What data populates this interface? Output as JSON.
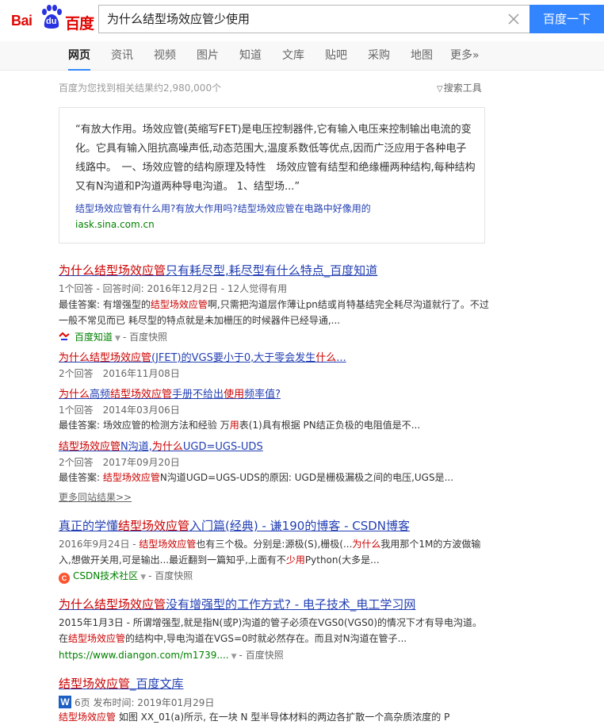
{
  "header": {
    "logo_left": "Bai",
    "logo_du": "du",
    "logo_right": "百度",
    "query": "为什么结型场效应管少使用",
    "search_button": "百度一下"
  },
  "tabs": [
    "网页",
    "资讯",
    "视频",
    "图片",
    "知道",
    "文库",
    "贴吧",
    "采购",
    "地图",
    "更多»"
  ],
  "stats": "百度为您找到相关结果约2,980,000个",
  "tools": "搜索工具",
  "answer": {
    "text": "“有放大作用。场效应管(英缩写FET)是电压控制器件,它有输入电压来控制输出电流的变化。它具有输入阻抗高噪声低,动态范围大,温度系数低等优点,因而广泛应用于各种电子线路中。　一、场效应管的结构原理及特性　场效应管有结型和绝缘栅两种结构,每种结构又有N沟道和P沟道两种导电沟道。 1、结型场...”",
    "link": "结型场效应管有什么用?有放大作用吗?结型场效应管在电路中好像用的",
    "url": "iask.sina.com.cn"
  },
  "result1": {
    "title_em1": "为什么结型场效应管",
    "title_rest": "只有耗尽型,耗尽型有什么特点_百度知道",
    "meta": "1个回答 - 回答时间: 2016年12月2日 - 12人觉得有用",
    "abs_pre": "最佳答案: 有增强型的",
    "abs_em": "结型场效应管",
    "abs_post": "啊,只需把沟道层作薄让pn结或肖特基结完全耗尽沟道就行了。不过一般不常见而已 耗尽型的特点就是未加栅压的时候器件已经导通,...",
    "source": "百度知道",
    "snapshot": "百度快照",
    "sub1_title_em": "为什么结型场效应管",
    "sub1_title_rest": "(JFET)的VGS要小于0,大于零会发生",
    "sub1_title_em2": "什么",
    "sub1_title_end": "...",
    "sub1_meta": "2个回答　2016年11月08日",
    "sub2_title_em": "为什么",
    "sub2_title_mid": "高频",
    "sub2_title_em2": "结型场效应管",
    "sub2_title_rest": "手册不给出",
    "sub2_title_em3": "使用",
    "sub2_title_end": "频率值?",
    "sub2_meta": "1个回答　2014年03月06日",
    "sub2_abs_pre": "最佳答案: 场效应管的检测方法和经验 万",
    "sub2_abs_em": "用",
    "sub2_abs_post": "表(1)具有根据 PN结正负极的电阻值是不...",
    "sub3_title_em": "结型场效应管",
    "sub3_title_mid": "N沟道,",
    "sub3_title_em2": "为什么",
    "sub3_title_end": "UGD=UGS-UDS",
    "sub3_meta": "2个回答　2017年09月20日",
    "sub3_abs_pre": "最佳答案: ",
    "sub3_abs_em": "结型场效应管",
    "sub3_abs_post": "N沟道UGD=UGS-UDS的原因: UGD是栅极漏极之间的电压,UGS是...",
    "more": "更多同站结果>>"
  },
  "result2": {
    "title_pre": "真正的学懂",
    "title_em": "结型场效应管",
    "title_rest": "入门篇(经典) - 谦190的博客 - CSDN博客",
    "abs_pre": "2016年9月24日 - ",
    "abs_em": "结型场效应管",
    "abs_mid": "也有三个极。分别是:源极(S),栅极(...",
    "abs_em2": "为什么",
    "abs_mid2": "我用那个1M的方波做输入,想做开关用,可是输出...最近翻到一篇知乎,上面有不",
    "abs_em3": "少用",
    "abs_end": "Python(大多是...",
    "source": "CSDN技术社区",
    "snapshot": "百度快照"
  },
  "result3": {
    "title_em": "为什么结型场效应管",
    "title_rest": "没有增强型的工作方式? - 电子技术_电工学习网",
    "abs_pre": "2015年1月3日 - 所谓增强型,就是指N(或P)沟道的管子必须在VGS0(VGS0)的情况下才有导电沟道。在",
    "abs_em": "结型场效应管",
    "abs_post": "的结构中,导电沟道在VGS=0时就必然存在。而且对N沟道在管子...",
    "url": "https://www.diangon.com/m1739....",
    "snapshot": "百度快照"
  },
  "result4": {
    "title_em": "结型场效应管",
    "title_rest": "_百度文库",
    "icon": "W",
    "meta": "6页 发布时间: 2019年01月29日",
    "abs_em": "结型场效应管",
    "abs_post": " 如图 XX_01(a)所示, 在一块 N 型半导体材料的两边各扩散一个高杂质浓度的 P"
  }
}
